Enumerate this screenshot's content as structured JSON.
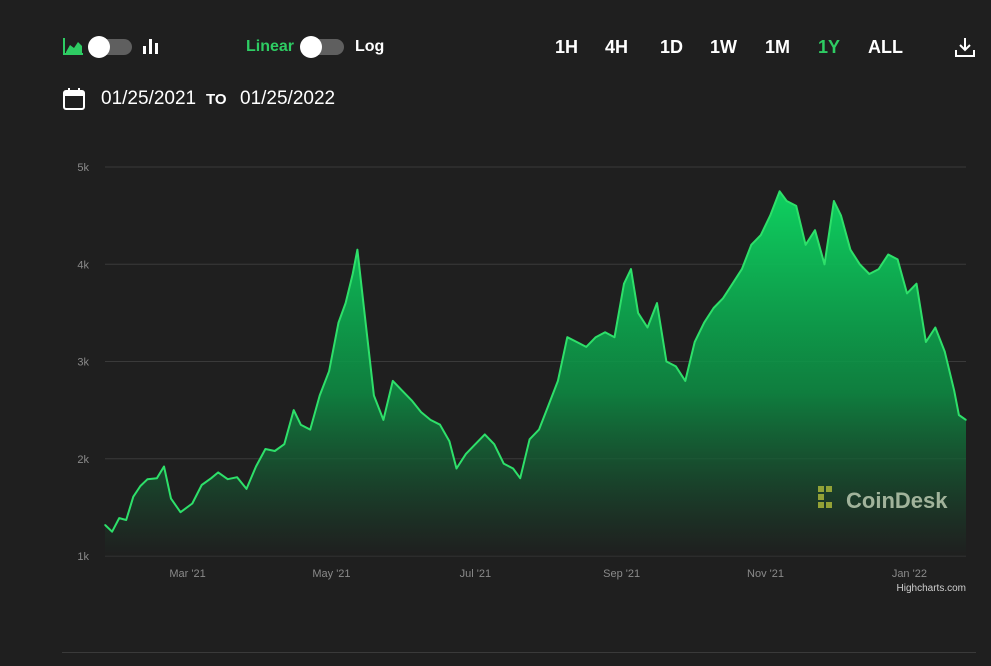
{
  "toolbar": {
    "chart_type_icons": [
      "area-chart-icon",
      "bar-chart-icon"
    ],
    "scale_linear_label": "Linear",
    "scale_log_label": "Log",
    "ranges": [
      "1H",
      "4H",
      "1D",
      "1W",
      "1M",
      "1Y",
      "ALL"
    ],
    "active_range": "1Y",
    "download_icon": "download-icon"
  },
  "date_range": {
    "from": "01/25/2021",
    "to_label": "TO",
    "to": "01/25/2022",
    "icon": "calendar-icon"
  },
  "colors": {
    "background": "#1f1f1f",
    "accent_green": "#2ecc63",
    "line": "#2ee06a",
    "grid": "#3a3a3a",
    "axis_text": "#8a8a8a"
  },
  "watermark": "CoinDesk",
  "credit": "Highcharts.com",
  "chart_data": {
    "type": "area",
    "x_start": "2021-01-25",
    "x_end": "2022-01-25",
    "x_ticks": [
      "Mar '21",
      "May '21",
      "Jul '21",
      "Sep '21",
      "Nov '21",
      "Jan '22"
    ],
    "x_tick_dates": [
      "2021-03-01",
      "2021-05-01",
      "2021-07-01",
      "2021-09-01",
      "2021-11-01",
      "2022-01-01"
    ],
    "y_ticks": [
      "1k",
      "2k",
      "3k",
      "4k",
      "5k"
    ],
    "y_tick_values": [
      1000,
      2000,
      3000,
      4000,
      5000
    ],
    "ylim": [
      1000,
      5000
    ],
    "grid": true,
    "series": [
      {
        "x": [
          "2021-01-25",
          "2021-01-28",
          "2021-01-31",
          "2021-02-03",
          "2021-02-06",
          "2021-02-09",
          "2021-02-12",
          "2021-02-16",
          "2021-02-19",
          "2021-02-22",
          "2021-02-26",
          "2021-03-03",
          "2021-03-07",
          "2021-03-11",
          "2021-03-14",
          "2021-03-18",
          "2021-03-22",
          "2021-03-26",
          "2021-03-30",
          "2021-04-03",
          "2021-04-07",
          "2021-04-11",
          "2021-04-15",
          "2021-04-18",
          "2021-04-22",
          "2021-04-26",
          "2021-04-30",
          "2021-05-04",
          "2021-05-07",
          "2021-05-10",
          "2021-05-12",
          "2021-05-15",
          "2021-05-19",
          "2021-05-23",
          "2021-05-27",
          "2021-05-31",
          "2021-06-04",
          "2021-06-08",
          "2021-06-12",
          "2021-06-16",
          "2021-06-20",
          "2021-06-23",
          "2021-06-27",
          "2021-07-01",
          "2021-07-05",
          "2021-07-09",
          "2021-07-13",
          "2021-07-17",
          "2021-07-20",
          "2021-07-24",
          "2021-07-28",
          "2021-08-01",
          "2021-08-05",
          "2021-08-09",
          "2021-08-13",
          "2021-08-17",
          "2021-08-21",
          "2021-08-25",
          "2021-08-29",
          "2021-09-02",
          "2021-09-05",
          "2021-09-08",
          "2021-09-12",
          "2021-09-16",
          "2021-09-20",
          "2021-09-24",
          "2021-09-28",
          "2021-10-02",
          "2021-10-06",
          "2021-10-10",
          "2021-10-14",
          "2021-10-18",
          "2021-10-22",
          "2021-10-26",
          "2021-10-30",
          "2021-11-03",
          "2021-11-07",
          "2021-11-10",
          "2021-11-14",
          "2021-11-18",
          "2021-11-22",
          "2021-11-26",
          "2021-11-30",
          "2021-12-03",
          "2021-12-07",
          "2021-12-11",
          "2021-12-15",
          "2021-12-19",
          "2021-12-23",
          "2021-12-27",
          "2021-12-31",
          "2022-01-04",
          "2022-01-08",
          "2022-01-12",
          "2022-01-16",
          "2022-01-20",
          "2022-01-22",
          "2022-01-25"
        ],
        "values": [
          1320,
          1250,
          1390,
          1370,
          1610,
          1720,
          1790,
          1800,
          1920,
          1590,
          1450,
          1540,
          1730,
          1800,
          1860,
          1790,
          1810,
          1690,
          1920,
          2100,
          2080,
          2150,
          2500,
          2350,
          2300,
          2650,
          2900,
          3400,
          3600,
          3900,
          4150,
          3500,
          2650,
          2400,
          2800,
          2700,
          2600,
          2480,
          2400,
          2350,
          2180,
          1900,
          2050,
          2150,
          2250,
          2150,
          1950,
          1900,
          1800,
          2200,
          2300,
          2550,
          2800,
          3250,
          3200,
          3150,
          3250,
          3300,
          3250,
          3800,
          3950,
          3500,
          3350,
          3600,
          3000,
          2950,
          2800,
          3200,
          3400,
          3550,
          3650,
          3800,
          3950,
          4200,
          4300,
          4500,
          4750,
          4650,
          4600,
          4200,
          4350,
          4000,
          4650,
          4500,
          4150,
          4000,
          3900,
          3950,
          4100,
          4050,
          3700,
          3800,
          3200,
          3350,
          3100,
          2700,
          2450,
          2400
        ]
      }
    ]
  }
}
